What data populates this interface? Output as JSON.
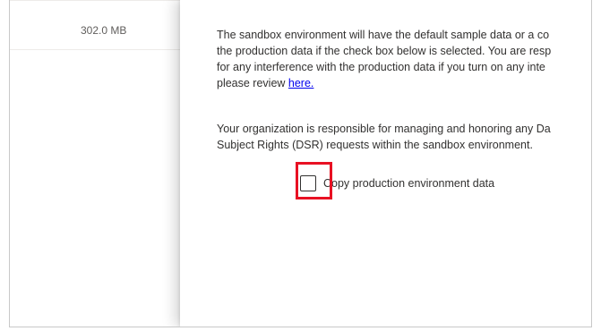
{
  "background_table": {
    "row_size": "302.0 MB"
  },
  "panel": {
    "paragraph1_lines": [
      "The sandbox environment will have the default sample data or a co",
      "the production data if the check box below is selected. You are resp",
      "for any interference with the production data if you turn on any inte"
    ],
    "paragraph1_tail": "please review ",
    "link_text": "here.",
    "paragraph2_lines": [
      "Your organization is responsible for managing and honoring any Da",
      "Subject Rights (DSR) requests within the sandbox environment."
    ],
    "checkbox_label": "Copy production environment data",
    "checkbox_checked": false
  },
  "colors": {
    "highlight": "#e81123",
    "link": "#0000ee",
    "text": "#323130"
  }
}
